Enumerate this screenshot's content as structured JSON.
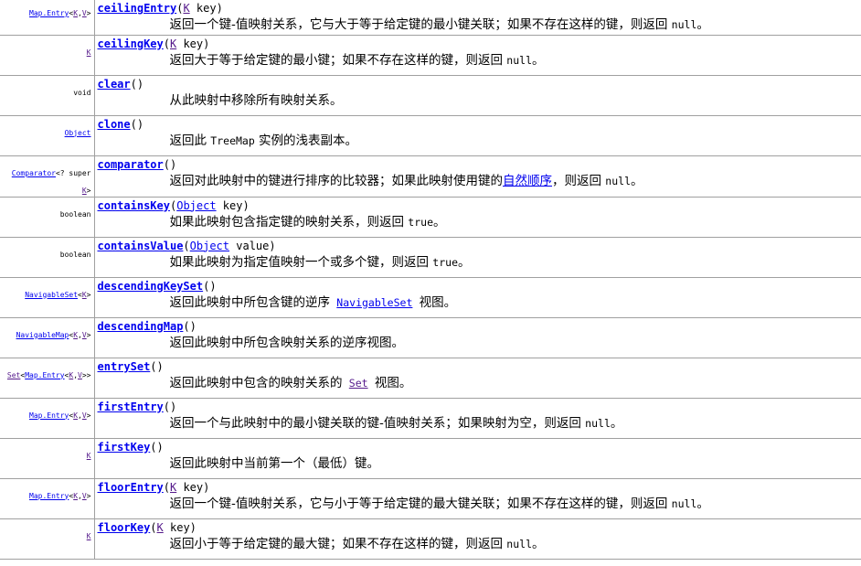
{
  "methods": [
    {
      "type_tokens": [
        {
          "text": "Map.Entry",
          "style": "link"
        },
        {
          "text": "<",
          "style": "plain"
        },
        {
          "text": "K",
          "style": "link-v"
        },
        {
          "text": ",",
          "style": "plain"
        },
        {
          "text": "V",
          "style": "link-v"
        },
        {
          "text": ">",
          "style": "plain"
        }
      ],
      "name": "ceilingEntry",
      "sig_tokens": [
        {
          "text": "(",
          "style": "plain"
        },
        {
          "text": "K",
          "style": "link-v"
        },
        {
          "text": " key)",
          "style": "plain"
        }
      ],
      "desc": [
        {
          "text": "返回一个键-值映射关系，它与大于等于给定键的最小键关联；如果不存在这样的键，则返回 ",
          "style": "text"
        },
        {
          "text": "null",
          "style": "code"
        },
        {
          "text": "。",
          "style": "text"
        }
      ]
    },
    {
      "type_tokens": [
        {
          "text": "K",
          "style": "link-v"
        }
      ],
      "name": "ceilingKey",
      "sig_tokens": [
        {
          "text": "(",
          "style": "plain"
        },
        {
          "text": "K",
          "style": "link-v"
        },
        {
          "text": " key)",
          "style": "plain"
        }
      ],
      "desc": [
        {
          "text": "返回大于等于给定键的最小键；如果不存在这样的键，则返回 ",
          "style": "text"
        },
        {
          "text": "null",
          "style": "code"
        },
        {
          "text": "。",
          "style": "text"
        }
      ]
    },
    {
      "type_tokens": [
        {
          "text": "void",
          "style": "plain"
        }
      ],
      "name": "clear",
      "sig_tokens": [
        {
          "text": "()",
          "style": "plain"
        }
      ],
      "desc": [
        {
          "text": "从此映射中移除所有映射关系。",
          "style": "text"
        }
      ]
    },
    {
      "type_tokens": [
        {
          "text": "Object",
          "style": "link"
        }
      ],
      "name": "clone",
      "sig_tokens": [
        {
          "text": "()",
          "style": "plain"
        }
      ],
      "desc": [
        {
          "text": "返回此 ",
          "style": "text"
        },
        {
          "text": "TreeMap",
          "style": "code"
        },
        {
          "text": " 实例的浅表副本。",
          "style": "text"
        }
      ]
    },
    {
      "type_tokens": [
        {
          "text": "Comparator",
          "style": "link"
        },
        {
          "text": "<? super ",
          "style": "plain"
        },
        {
          "text": "\n",
          "style": "br"
        },
        {
          "text": "K",
          "style": "link-v"
        },
        {
          "text": ">",
          "style": "plain"
        }
      ],
      "name": "comparator",
      "sig_tokens": [
        {
          "text": "()",
          "style": "plain"
        }
      ],
      "desc": [
        {
          "text": "返回对此映射中的键进行排序的比较器；如果此映射使用键的",
          "style": "text"
        },
        {
          "text": "自然顺序",
          "style": "link"
        },
        {
          "text": "，则返回 ",
          "style": "text"
        },
        {
          "text": "null",
          "style": "code"
        },
        {
          "text": "。",
          "style": "text"
        }
      ]
    },
    {
      "type_tokens": [
        {
          "text": "boolean",
          "style": "plain"
        }
      ],
      "name": "containsKey",
      "sig_tokens": [
        {
          "text": "(",
          "style": "plain"
        },
        {
          "text": "Object",
          "style": "link"
        },
        {
          "text": " key)",
          "style": "plain"
        }
      ],
      "desc": [
        {
          "text": "如果此映射包含指定键的映射关系，则返回 ",
          "style": "text"
        },
        {
          "text": "true",
          "style": "code"
        },
        {
          "text": "。",
          "style": "text"
        }
      ]
    },
    {
      "type_tokens": [
        {
          "text": "boolean",
          "style": "plain"
        }
      ],
      "name": "containsValue",
      "sig_tokens": [
        {
          "text": "(",
          "style": "plain"
        },
        {
          "text": "Object",
          "style": "link"
        },
        {
          "text": " value)",
          "style": "plain"
        }
      ],
      "desc": [
        {
          "text": "如果此映射为指定值映射一个或多个键，则返回 ",
          "style": "text"
        },
        {
          "text": "true",
          "style": "code"
        },
        {
          "text": "。",
          "style": "text"
        }
      ]
    },
    {
      "type_tokens": [
        {
          "text": "NavigableSet",
          "style": "link"
        },
        {
          "text": "<",
          "style": "plain"
        },
        {
          "text": "K",
          "style": "link-v"
        },
        {
          "text": ">",
          "style": "plain"
        }
      ],
      "name": "descendingKeySet",
      "sig_tokens": [
        {
          "text": "()",
          "style": "plain"
        }
      ],
      "desc": [
        {
          "text": "返回此映射中所包含键的逆序 ",
          "style": "text"
        },
        {
          "text": "NavigableSet",
          "style": "code-link"
        },
        {
          "text": " 视图。",
          "style": "text"
        }
      ]
    },
    {
      "type_tokens": [
        {
          "text": "NavigableMap",
          "style": "link"
        },
        {
          "text": "<",
          "style": "plain"
        },
        {
          "text": "K",
          "style": "link-v"
        },
        {
          "text": ",",
          "style": "plain"
        },
        {
          "text": "V",
          "style": "link-v"
        },
        {
          "text": ">",
          "style": "plain"
        }
      ],
      "name": "descendingMap",
      "sig_tokens": [
        {
          "text": "()",
          "style": "plain"
        }
      ],
      "desc": [
        {
          "text": "返回此映射中所包含映射关系的逆序视图。",
          "style": "text"
        }
      ]
    },
    {
      "type_tokens": [
        {
          "text": "Set",
          "style": "link-v"
        },
        {
          "text": "<",
          "style": "plain"
        },
        {
          "text": "Map.Entry",
          "style": "link"
        },
        {
          "text": "<",
          "style": "plain"
        },
        {
          "text": "K",
          "style": "link-v"
        },
        {
          "text": ",",
          "style": "plain"
        },
        {
          "text": "V",
          "style": "link-v"
        },
        {
          "text": ">>",
          "style": "plain"
        }
      ],
      "name": "entrySet",
      "sig_tokens": [
        {
          "text": "()",
          "style": "plain"
        }
      ],
      "desc": [
        {
          "text": "返回此映射中包含的映射关系的 ",
          "style": "text"
        },
        {
          "text": "Set",
          "style": "code-link-v"
        },
        {
          "text": " 视图。",
          "style": "text"
        }
      ]
    },
    {
      "type_tokens": [
        {
          "text": "Map.Entry",
          "style": "link"
        },
        {
          "text": "<",
          "style": "plain"
        },
        {
          "text": "K",
          "style": "link-v"
        },
        {
          "text": ",",
          "style": "plain"
        },
        {
          "text": "V",
          "style": "link-v"
        },
        {
          "text": ">",
          "style": "plain"
        }
      ],
      "name": "firstEntry",
      "sig_tokens": [
        {
          "text": "()",
          "style": "plain"
        }
      ],
      "desc": [
        {
          "text": "返回一个与此映射中的最小键关联的键-值映射关系；如果映射为空，则返回 ",
          "style": "text"
        },
        {
          "text": "null",
          "style": "code"
        },
        {
          "text": "。",
          "style": "text"
        }
      ]
    },
    {
      "type_tokens": [
        {
          "text": "K",
          "style": "link-v"
        }
      ],
      "name": "firstKey",
      "sig_tokens": [
        {
          "text": "()",
          "style": "plain"
        }
      ],
      "desc": [
        {
          "text": "返回此映射中当前第一个（最低）键。",
          "style": "text"
        }
      ]
    },
    {
      "type_tokens": [
        {
          "text": "Map.Entry",
          "style": "link"
        },
        {
          "text": "<",
          "style": "plain"
        },
        {
          "text": "K",
          "style": "link-v"
        },
        {
          "text": ",",
          "style": "plain"
        },
        {
          "text": "V",
          "style": "link-v"
        },
        {
          "text": ">",
          "style": "plain"
        }
      ],
      "name": "floorEntry",
      "sig_tokens": [
        {
          "text": "(",
          "style": "plain"
        },
        {
          "text": "K",
          "style": "link-v"
        },
        {
          "text": " key)",
          "style": "plain"
        }
      ],
      "desc": [
        {
          "text": "返回一个键-值映射关系，它与小于等于给定键的最大键关联；如果不存在这样的键，则返回 ",
          "style": "text"
        },
        {
          "text": "null",
          "style": "code"
        },
        {
          "text": "。",
          "style": "text"
        }
      ]
    },
    {
      "type_tokens": [
        {
          "text": "K",
          "style": "link-v"
        }
      ],
      "name": "floorKey",
      "sig_tokens": [
        {
          "text": "(",
          "style": "plain"
        },
        {
          "text": "K",
          "style": "link-v"
        },
        {
          "text": " key)",
          "style": "plain"
        }
      ],
      "desc": [
        {
          "text": "返回小于等于给定键的最大键；如果不存在这样的键，则返回 ",
          "style": "text"
        },
        {
          "text": "null",
          "style": "code"
        },
        {
          "text": "。",
          "style": "text"
        }
      ]
    }
  ]
}
